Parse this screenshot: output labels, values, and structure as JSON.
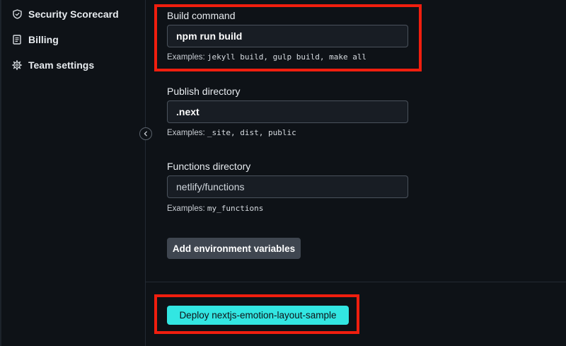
{
  "sidebar": {
    "items": [
      {
        "label": "Security Scorecard",
        "icon": "shield-icon"
      },
      {
        "label": "Billing",
        "icon": "receipt-icon"
      },
      {
        "label": "Team settings",
        "icon": "gear-icon"
      }
    ],
    "collapse_icon": "chevron-left-icon"
  },
  "build": {
    "command_label": "Build command",
    "command_value": "npm run build",
    "command_hint_prefix": "Examples:",
    "command_hint_code": "jekyll build, gulp build, make all",
    "publish_label": "Publish directory",
    "publish_value": ".next",
    "publish_hint_prefix": "Examples:",
    "publish_hint_code": "_site, dist, public",
    "functions_label": "Functions directory",
    "functions_value": "netlify/functions",
    "functions_hint_prefix": "Examples:",
    "functions_hint_code": "my_functions",
    "env_button_label": "Add environment variables"
  },
  "deploy": {
    "button_label": "Deploy nextjs-emotion-layout-sample"
  },
  "colors": {
    "background": "#0e1217",
    "accent": "#32e6e2",
    "highlight": "#f01e0e",
    "input_bg": "#181d24",
    "secondary_button": "#3f4650"
  }
}
